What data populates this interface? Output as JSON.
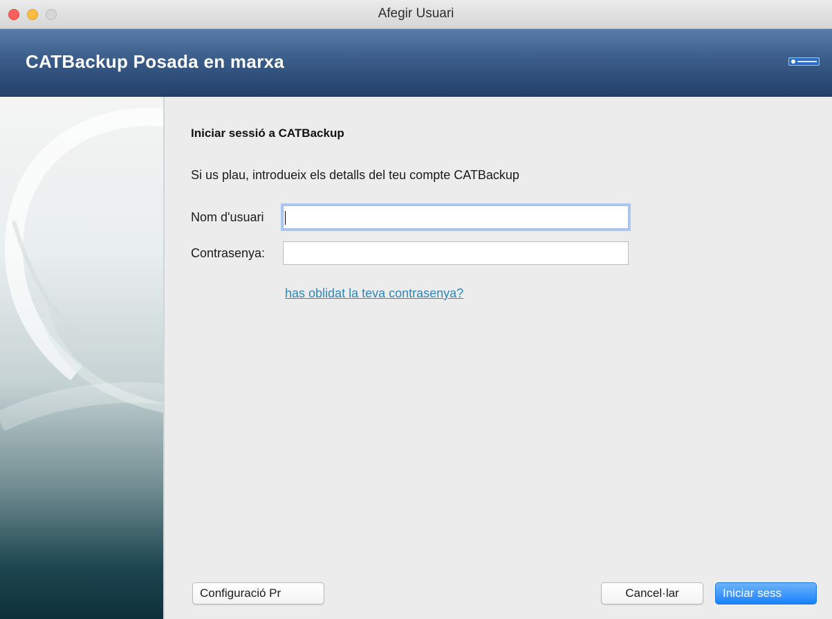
{
  "window": {
    "title": "Afegir Usuari"
  },
  "banner": {
    "title": "CATBackup Posada en marxa",
    "logo_icon": "catbackup-logo-icon"
  },
  "form": {
    "heading": "Iniciar sessió a CATBackup",
    "intro": "Si us plau, introdueix els detalls del teu compte CATBackup",
    "username": {
      "label": "Nom d'usuari",
      "value": ""
    },
    "password": {
      "label": "Contrasenya:",
      "value": ""
    },
    "forgot_link": "has oblidat la teva contrasenya?"
  },
  "buttons": {
    "settings": "Configuració Pr",
    "cancel": "Cancel·lar",
    "login": "Iniciar sess"
  },
  "colors": {
    "banner": "#3a5c88",
    "link": "#2f86b9",
    "primary_button": "#1a82fb",
    "focus_ring": "#a9c8f2"
  }
}
